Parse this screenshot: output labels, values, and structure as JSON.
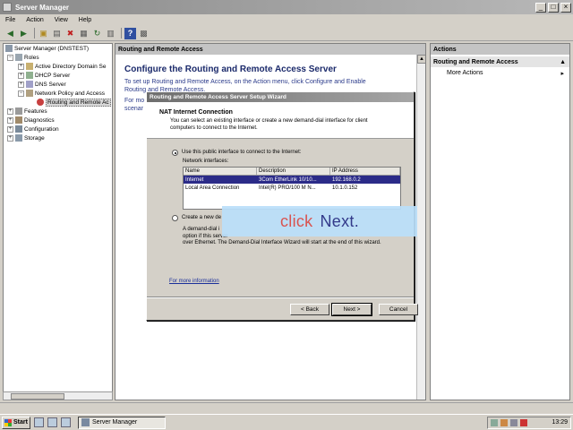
{
  "window": {
    "title": "Server Manager"
  },
  "menu": [
    "File",
    "Action",
    "View",
    "Help"
  ],
  "tree": {
    "root": "Server Manager (DNSTEST)",
    "roles": "Roles",
    "role_items": [
      "Active Directory Domain Se",
      "DHCP Server",
      "DNS Server",
      "Network Policy and Access"
    ],
    "selected": "Routing and Remote Ac",
    "others": [
      "Features",
      "Diagnostics",
      "Configuration",
      "Storage"
    ]
  },
  "center": {
    "header": "Routing and Remote Access",
    "heading": "Configure the Routing and Remote Access Server",
    "para_line1": "To set up Routing and Remote Access, on the Action menu, click Configure and Enable",
    "para_line2": "Routing and Remote Access.",
    "para2_line1": "For mo",
    "para2_line2": "scenar"
  },
  "actions": {
    "header": "Actions",
    "section": "Routing and Remote Access",
    "more": "More Actions"
  },
  "wizard": {
    "title": "Routing and Remote Access Server Setup Wizard",
    "page_title": "NAT Internet Connection",
    "page_desc": "You can select an existing interface or create a new demand-dial interface for client computers to connect to the Internet.",
    "option1": "Use this public interface to connect to the Internet:",
    "list_label": "Network interfaces:",
    "columns": [
      "Name",
      "Description",
      "IP Address"
    ],
    "rows": [
      {
        "name": "Internet",
        "desc": "3Com EtherLink 10/10...",
        "ip": "192.168.0.2"
      },
      {
        "name": "Local Area Connection",
        "desc": "Intel(R) PRO/100 M N...",
        "ip": "10.1.0.152"
      }
    ],
    "option2": "Create a new de",
    "demand_line1": "A demand-dial i",
    "demand_line2": "option if this server",
    "demand_line3": "over Ethernet. The Demand-Dial Interface Wizard will start at the end of this wizard.",
    "link": "For more information",
    "back": "< Back",
    "next": "Next >",
    "cancel": "Cancel"
  },
  "overlay": {
    "word1": "click",
    "word2": "Next."
  },
  "taskbar": {
    "start": "Start",
    "task": "Server Manager",
    "clock": "13:29"
  }
}
